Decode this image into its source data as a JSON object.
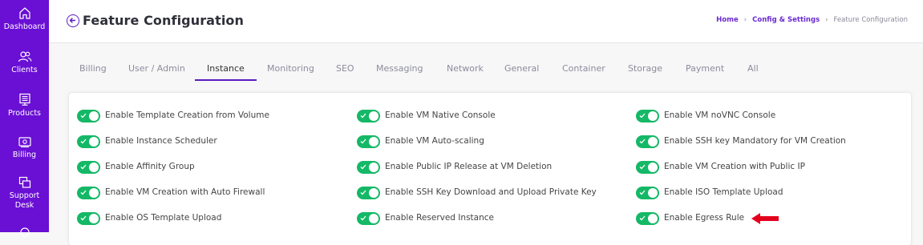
{
  "sidebar": {
    "items": [
      {
        "label_lines": [
          "Dashboard"
        ],
        "icon": "home-icon"
      },
      {
        "label_lines": [
          "Clients"
        ],
        "icon": "users-icon"
      },
      {
        "label_lines": [
          "Products"
        ],
        "icon": "server-icon"
      },
      {
        "label_lines": [
          "Billing"
        ],
        "icon": "wallet-icon"
      },
      {
        "label_lines": [
          "Support",
          "Desk"
        ],
        "icon": "copy-icon"
      }
    ]
  },
  "header": {
    "title": "Feature Configuration",
    "breadcrumb": [
      "Home",
      "Config & Settings",
      "Feature Configuration"
    ]
  },
  "tabs": [
    {
      "label": "Billing",
      "active": false
    },
    {
      "label": "User / Admin",
      "active": false
    },
    {
      "label": "Instance",
      "active": true
    },
    {
      "label": "Monitoring",
      "active": false
    },
    {
      "label": "SEO",
      "active": false
    },
    {
      "label": "Messaging",
      "active": false
    },
    {
      "label": "Network",
      "active": false
    },
    {
      "label": "General",
      "active": false
    },
    {
      "label": "Container",
      "active": false
    },
    {
      "label": "Storage",
      "active": false
    },
    {
      "label": "Payment",
      "active": false
    },
    {
      "label": "All",
      "active": false
    }
  ],
  "options": [
    {
      "label": "Enable Template Creation from Volume",
      "enabled": true
    },
    {
      "label": "Enable VM Native Console",
      "enabled": true
    },
    {
      "label": "Enable VM noVNC Console",
      "enabled": true
    },
    {
      "label": "Enable Instance Scheduler",
      "enabled": true
    },
    {
      "label": "Enable VM Auto-scaling",
      "enabled": true
    },
    {
      "label": "Enable SSH key Mandatory for VM Creation",
      "enabled": true
    },
    {
      "label": "Enable Affinity Group",
      "enabled": true
    },
    {
      "label": "Enable Public IP Release at VM Deletion",
      "enabled": true
    },
    {
      "label": "Enable VM Creation with Public IP",
      "enabled": true
    },
    {
      "label": "Enable VM Creation with Auto Firewall",
      "enabled": true
    },
    {
      "label": "Enable SSH Key Download and Upload Private Key",
      "enabled": true
    },
    {
      "label": "Enable ISO Template Upload",
      "enabled": true
    },
    {
      "label": "Enable OS Template Upload",
      "enabled": true
    },
    {
      "label": "Enable Reserved Instance",
      "enabled": true
    },
    {
      "label": "Enable Egress Rule",
      "enabled": true
    }
  ],
  "colors": {
    "sidebar": "#6a0fd4",
    "accent": "#5b1bbf",
    "toggle_on": "#14b866",
    "annotation_arrow": "#e3001b"
  }
}
